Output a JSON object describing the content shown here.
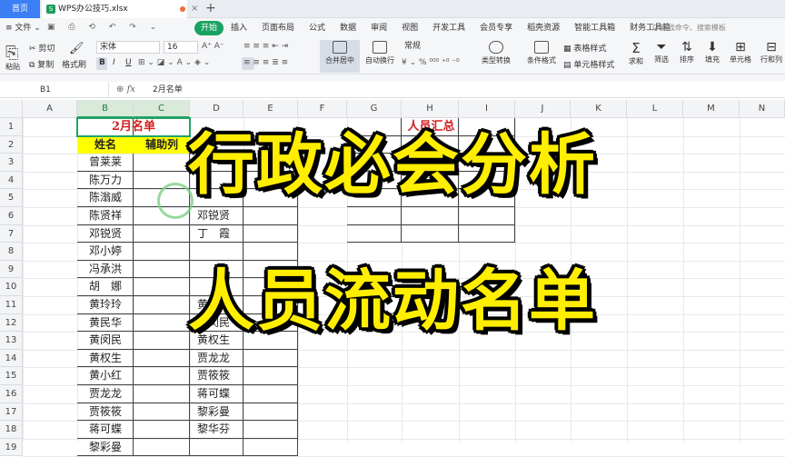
{
  "titlebar": {
    "home_tab": "首页",
    "file_name": "WPS办公技巧.xlsx",
    "close_glyph": "×",
    "new_tab_glyph": "+"
  },
  "menubar": {
    "file_menu": "≡ 文件 ⌄",
    "items": [
      "开始",
      "插入",
      "页面布局",
      "公式",
      "数据",
      "审阅",
      "视图",
      "开发工具",
      "会员专享",
      "稻壳资源",
      "智能工具箱",
      "财务工具箱"
    ],
    "search_placeholder": "Q 查找命令、搜索模板"
  },
  "ribbon": {
    "paste": "粘贴",
    "cut": "✂ 剪切",
    "copy": "复制",
    "format_painter": "格式刷",
    "font_name": "宋体",
    "font_size": "16",
    "merge_center": "合并居中",
    "wrap_text": "自动换行",
    "number_format": "常规",
    "type_convert": "类型转换",
    "conditional_format": "条件格式",
    "table_style": "表格样式",
    "cell_style": "单元格样式",
    "sum": "求和",
    "filter": "筛选",
    "sort": "排序",
    "fill": "填充",
    "cell": "单元格",
    "row_col": "行和列"
  },
  "formulabar": {
    "cell_ref": "B1",
    "fx_label": "fx",
    "content": "2月名单"
  },
  "sheet": {
    "columns": [
      "A",
      "B",
      "C",
      "D",
      "E",
      "F",
      "G",
      "H",
      "I",
      "J",
      "K",
      "L",
      "M",
      "N"
    ],
    "rows": [
      "1",
      "2",
      "3",
      "4",
      "5",
      "6",
      "7",
      "8",
      "9",
      "10",
      "11",
      "12",
      "13",
      "14",
      "15",
      "16",
      "17",
      "18",
      "19"
    ],
    "b1_title": "2月名单",
    "g1_title": "人员汇总",
    "b2_header": "姓名",
    "c2_header": "辅助列",
    "col_b_names": [
      "曾莱莱",
      "陈万力",
      "陈滃威",
      "陈贤祥",
      "邓锐贤",
      "邓小婷",
      "冯承洪",
      "胡　娜",
      "黄玲玲",
      "黄民华",
      "黄闵民",
      "黄权生",
      "黄小红",
      "贾龙龙",
      "贾筱筱",
      "蒋可蝶",
      "黎彩曼"
    ],
    "col_d_names": [
      "",
      "",
      "",
      "邓锐贤",
      "丁　霞",
      "",
      "",
      "",
      "黄民",
      "黄闵民",
      "黄权生",
      "贾龙龙",
      "贾筱筱",
      "蒋可蝶",
      "黎彩曼",
      "黎华芬"
    ]
  },
  "overlay": {
    "line1": "行政必会分析",
    "line2": "人员流动名单"
  }
}
